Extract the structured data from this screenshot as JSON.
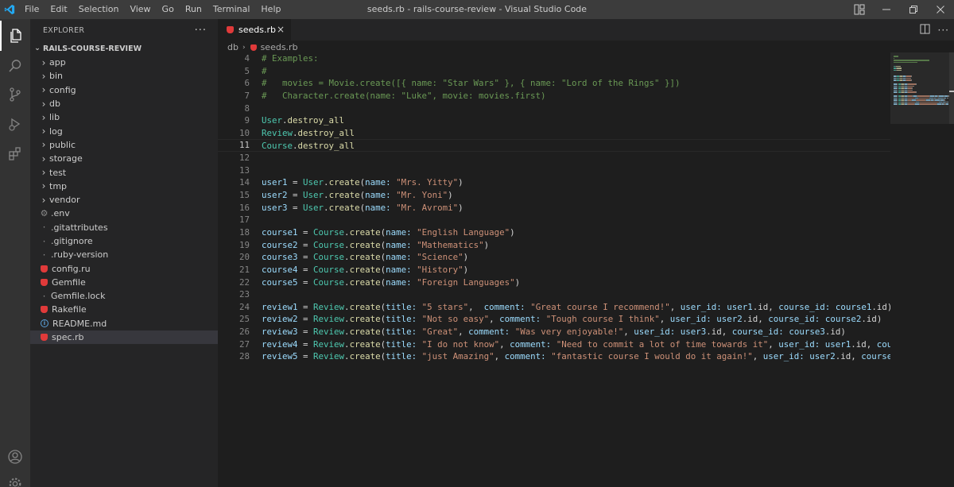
{
  "window": {
    "title": "seeds.rb - rails-course-review - Visual Studio Code",
    "menu": [
      "File",
      "Edit",
      "Selection",
      "View",
      "Go",
      "Run",
      "Terminal",
      "Help"
    ]
  },
  "explorer": {
    "header": "EXPLORER",
    "more": "···",
    "project": "RAILS-COURSE-REVIEW",
    "items": [
      {
        "label": "app",
        "kind": "folder"
      },
      {
        "label": "bin",
        "kind": "folder"
      },
      {
        "label": "config",
        "kind": "folder"
      },
      {
        "label": "db",
        "kind": "folder"
      },
      {
        "label": "lib",
        "kind": "folder"
      },
      {
        "label": "log",
        "kind": "folder"
      },
      {
        "label": "public",
        "kind": "folder"
      },
      {
        "label": "storage",
        "kind": "folder"
      },
      {
        "label": "test",
        "kind": "folder"
      },
      {
        "label": "tmp",
        "kind": "folder"
      },
      {
        "label": "vendor",
        "kind": "folder"
      },
      {
        "label": ".env",
        "kind": "gear"
      },
      {
        "label": ".gitattributes",
        "kind": "dot"
      },
      {
        "label": ".gitignore",
        "kind": "dot"
      },
      {
        "label": ".ruby-version",
        "kind": "dot"
      },
      {
        "label": "config.ru",
        "kind": "ruby"
      },
      {
        "label": "Gemfile",
        "kind": "ruby"
      },
      {
        "label": "Gemfile.lock",
        "kind": "dot"
      },
      {
        "label": "Rakefile",
        "kind": "ruby"
      },
      {
        "label": "README.md",
        "kind": "info"
      },
      {
        "label": "spec.rb",
        "kind": "ruby",
        "selected": true
      }
    ]
  },
  "tab": {
    "label": "seeds.rb",
    "close": "×"
  },
  "breadcrumb": {
    "folder": "db",
    "file": "seeds.rb"
  },
  "editor": {
    "current_line": 11,
    "lines": [
      {
        "n": 4,
        "tokens": [
          [
            "com",
            "# Examples:"
          ]
        ]
      },
      {
        "n": 5,
        "tokens": [
          [
            "com",
            "#"
          ]
        ]
      },
      {
        "n": 6,
        "tokens": [
          [
            "com",
            "#   movies = Movie.create([{ name: \"Star Wars\" }, { name: \"Lord of the Rings\" }])"
          ]
        ]
      },
      {
        "n": 7,
        "tokens": [
          [
            "com",
            "#   Character.create(name: \"Luke\", movie: movies.first)"
          ]
        ]
      },
      {
        "n": 8,
        "tokens": []
      },
      {
        "n": 9,
        "tokens": [
          [
            "cls",
            "User"
          ],
          [
            "op",
            "."
          ],
          [
            "mth",
            "destroy_all"
          ]
        ]
      },
      {
        "n": 10,
        "tokens": [
          [
            "cls",
            "Review"
          ],
          [
            "op",
            "."
          ],
          [
            "mth",
            "destroy_all"
          ]
        ]
      },
      {
        "n": 11,
        "tokens": [
          [
            "cls",
            "Course"
          ],
          [
            "op",
            "."
          ],
          [
            "mth",
            "destroy_all"
          ]
        ]
      },
      {
        "n": 12,
        "tokens": []
      },
      {
        "n": 13,
        "tokens": []
      },
      {
        "n": 14,
        "tokens": [
          [
            "var",
            "user1"
          ],
          [
            "op",
            " = "
          ],
          [
            "cls",
            "User"
          ],
          [
            "op",
            "."
          ],
          [
            "mth",
            "create"
          ],
          [
            "op",
            "("
          ],
          [
            "key",
            "name:"
          ],
          [
            "op",
            " "
          ],
          [
            "str",
            "\"Mrs. Yitty\""
          ],
          [
            "op",
            ")"
          ]
        ]
      },
      {
        "n": 15,
        "tokens": [
          [
            "var",
            "user2"
          ],
          [
            "op",
            " = "
          ],
          [
            "cls",
            "User"
          ],
          [
            "op",
            "."
          ],
          [
            "mth",
            "create"
          ],
          [
            "op",
            "("
          ],
          [
            "key",
            "name:"
          ],
          [
            "op",
            " "
          ],
          [
            "str",
            "\"Mr. Yoni\""
          ],
          [
            "op",
            ")"
          ]
        ]
      },
      {
        "n": 16,
        "tokens": [
          [
            "var",
            "user3"
          ],
          [
            "op",
            " = "
          ],
          [
            "cls",
            "User"
          ],
          [
            "op",
            "."
          ],
          [
            "mth",
            "create"
          ],
          [
            "op",
            "("
          ],
          [
            "key",
            "name:"
          ],
          [
            "op",
            " "
          ],
          [
            "str",
            "\"Mr. Avromi\""
          ],
          [
            "op",
            ")"
          ]
        ]
      },
      {
        "n": 17,
        "tokens": []
      },
      {
        "n": 18,
        "tokens": [
          [
            "var",
            "course1"
          ],
          [
            "op",
            " = "
          ],
          [
            "cls",
            "Course"
          ],
          [
            "op",
            "."
          ],
          [
            "mth",
            "create"
          ],
          [
            "op",
            "("
          ],
          [
            "key",
            "name:"
          ],
          [
            "op",
            " "
          ],
          [
            "str",
            "\"English Language\""
          ],
          [
            "op",
            ")"
          ]
        ]
      },
      {
        "n": 19,
        "tokens": [
          [
            "var",
            "course2"
          ],
          [
            "op",
            " = "
          ],
          [
            "cls",
            "Course"
          ],
          [
            "op",
            "."
          ],
          [
            "mth",
            "create"
          ],
          [
            "op",
            "("
          ],
          [
            "key",
            "name:"
          ],
          [
            "op",
            " "
          ],
          [
            "str",
            "\"Mathematics\""
          ],
          [
            "op",
            ")"
          ]
        ]
      },
      {
        "n": 20,
        "tokens": [
          [
            "var",
            "course3"
          ],
          [
            "op",
            " = "
          ],
          [
            "cls",
            "Course"
          ],
          [
            "op",
            "."
          ],
          [
            "mth",
            "create"
          ],
          [
            "op",
            "("
          ],
          [
            "key",
            "name:"
          ],
          [
            "op",
            " "
          ],
          [
            "str",
            "\"Science\""
          ],
          [
            "op",
            ")"
          ]
        ]
      },
      {
        "n": 21,
        "tokens": [
          [
            "var",
            "course4"
          ],
          [
            "op",
            " = "
          ],
          [
            "cls",
            "Course"
          ],
          [
            "op",
            "."
          ],
          [
            "mth",
            "create"
          ],
          [
            "op",
            "("
          ],
          [
            "key",
            "name:"
          ],
          [
            "op",
            " "
          ],
          [
            "str",
            "\"History\""
          ],
          [
            "op",
            ")"
          ]
        ]
      },
      {
        "n": 22,
        "tokens": [
          [
            "var",
            "course5"
          ],
          [
            "op",
            " = "
          ],
          [
            "cls",
            "Course"
          ],
          [
            "op",
            "."
          ],
          [
            "mth",
            "create"
          ],
          [
            "op",
            "("
          ],
          [
            "key",
            "name:"
          ],
          [
            "op",
            " "
          ],
          [
            "str",
            "\"Foreign Languages\""
          ],
          [
            "op",
            ")"
          ]
        ]
      },
      {
        "n": 23,
        "tokens": []
      },
      {
        "n": 24,
        "tokens": [
          [
            "var",
            "review1"
          ],
          [
            "op",
            " = "
          ],
          [
            "cls",
            "Review"
          ],
          [
            "op",
            "."
          ],
          [
            "mth",
            "create"
          ],
          [
            "op",
            "("
          ],
          [
            "key",
            "title:"
          ],
          [
            "op",
            " "
          ],
          [
            "str",
            "\"5 stars\""
          ],
          [
            "op",
            ",  "
          ],
          [
            "key",
            "comment:"
          ],
          [
            "op",
            " "
          ],
          [
            "str",
            "\"Great course I recommend!\""
          ],
          [
            "op",
            ", "
          ],
          [
            "key",
            "user_id:"
          ],
          [
            "op",
            " "
          ],
          [
            "var",
            "user1"
          ],
          [
            "op",
            ".id, "
          ],
          [
            "key",
            "course_id:"
          ],
          [
            "op",
            " "
          ],
          [
            "var",
            "course1"
          ],
          [
            "op",
            ".id)"
          ]
        ]
      },
      {
        "n": 25,
        "tokens": [
          [
            "var",
            "review2"
          ],
          [
            "op",
            " = "
          ],
          [
            "cls",
            "Review"
          ],
          [
            "op",
            "."
          ],
          [
            "mth",
            "create"
          ],
          [
            "op",
            "("
          ],
          [
            "key",
            "title:"
          ],
          [
            "op",
            " "
          ],
          [
            "str",
            "\"Not so easy\""
          ],
          [
            "op",
            ", "
          ],
          [
            "key",
            "comment:"
          ],
          [
            "op",
            " "
          ],
          [
            "str",
            "\"Tough course I think\""
          ],
          [
            "op",
            ", "
          ],
          [
            "key",
            "user_id:"
          ],
          [
            "op",
            " "
          ],
          [
            "var",
            "user2"
          ],
          [
            "op",
            ".id, "
          ],
          [
            "key",
            "course_id:"
          ],
          [
            "op",
            " "
          ],
          [
            "var",
            "course2"
          ],
          [
            "op",
            ".id)"
          ]
        ]
      },
      {
        "n": 26,
        "tokens": [
          [
            "var",
            "review3"
          ],
          [
            "op",
            " = "
          ],
          [
            "cls",
            "Review"
          ],
          [
            "op",
            "."
          ],
          [
            "mth",
            "create"
          ],
          [
            "op",
            "("
          ],
          [
            "key",
            "title:"
          ],
          [
            "op",
            " "
          ],
          [
            "str",
            "\"Great\""
          ],
          [
            "op",
            ", "
          ],
          [
            "key",
            "comment:"
          ],
          [
            "op",
            " "
          ],
          [
            "str",
            "\"Was very enjoyable!\""
          ],
          [
            "op",
            ", "
          ],
          [
            "key",
            "user_id:"
          ],
          [
            "op",
            " "
          ],
          [
            "var",
            "user3"
          ],
          [
            "op",
            ".id, "
          ],
          [
            "key",
            "course_id:"
          ],
          [
            "op",
            " "
          ],
          [
            "var",
            "course3"
          ],
          [
            "op",
            ".id)"
          ]
        ]
      },
      {
        "n": 27,
        "tokens": [
          [
            "var",
            "review4"
          ],
          [
            "op",
            " = "
          ],
          [
            "cls",
            "Review"
          ],
          [
            "op",
            "."
          ],
          [
            "mth",
            "create"
          ],
          [
            "op",
            "("
          ],
          [
            "key",
            "title:"
          ],
          [
            "op",
            " "
          ],
          [
            "str",
            "\"I do not know\""
          ],
          [
            "op",
            ", "
          ],
          [
            "key",
            "comment:"
          ],
          [
            "op",
            " "
          ],
          [
            "str",
            "\"Need to commit a lot of time towards it\""
          ],
          [
            "op",
            ", "
          ],
          [
            "key",
            "user_id:"
          ],
          [
            "op",
            " "
          ],
          [
            "var",
            "user1"
          ],
          [
            "op",
            ".id, "
          ],
          [
            "key",
            "cou"
          ]
        ]
      },
      {
        "n": 28,
        "tokens": [
          [
            "var",
            "review5"
          ],
          [
            "op",
            " = "
          ],
          [
            "cls",
            "Review"
          ],
          [
            "op",
            "."
          ],
          [
            "mth",
            "create"
          ],
          [
            "op",
            "("
          ],
          [
            "key",
            "title:"
          ],
          [
            "op",
            " "
          ],
          [
            "str",
            "\"just Amazing\""
          ],
          [
            "op",
            ", "
          ],
          [
            "key",
            "comment:"
          ],
          [
            "op",
            " "
          ],
          [
            "str",
            "\"fantastic course I would do it again!\""
          ],
          [
            "op",
            ", "
          ],
          [
            "key",
            "user_id:"
          ],
          [
            "op",
            " "
          ],
          [
            "var",
            "user2"
          ],
          [
            "op",
            ".id, "
          ],
          [
            "key",
            "course"
          ]
        ]
      }
    ]
  },
  "colors": {
    "titlebar": "#3c3c3c",
    "activitybar": "#333333",
    "sidebar": "#252526",
    "editor": "#1e1e1e",
    "accent_blue": "#007acc",
    "ruby_red": "#e03a3a"
  },
  "icons": {
    "app": "vscode-logo-icon",
    "activity": [
      "explorer-icon",
      "search-icon",
      "source-control-icon",
      "run-debug-icon",
      "extensions-icon",
      "account-icon",
      "manage-gear-icon"
    ],
    "window": [
      "layout-icon",
      "minimize-icon",
      "restore-icon",
      "close-icon"
    ],
    "editor_actions": [
      "split-editor-icon",
      "more-actions-icon"
    ]
  }
}
